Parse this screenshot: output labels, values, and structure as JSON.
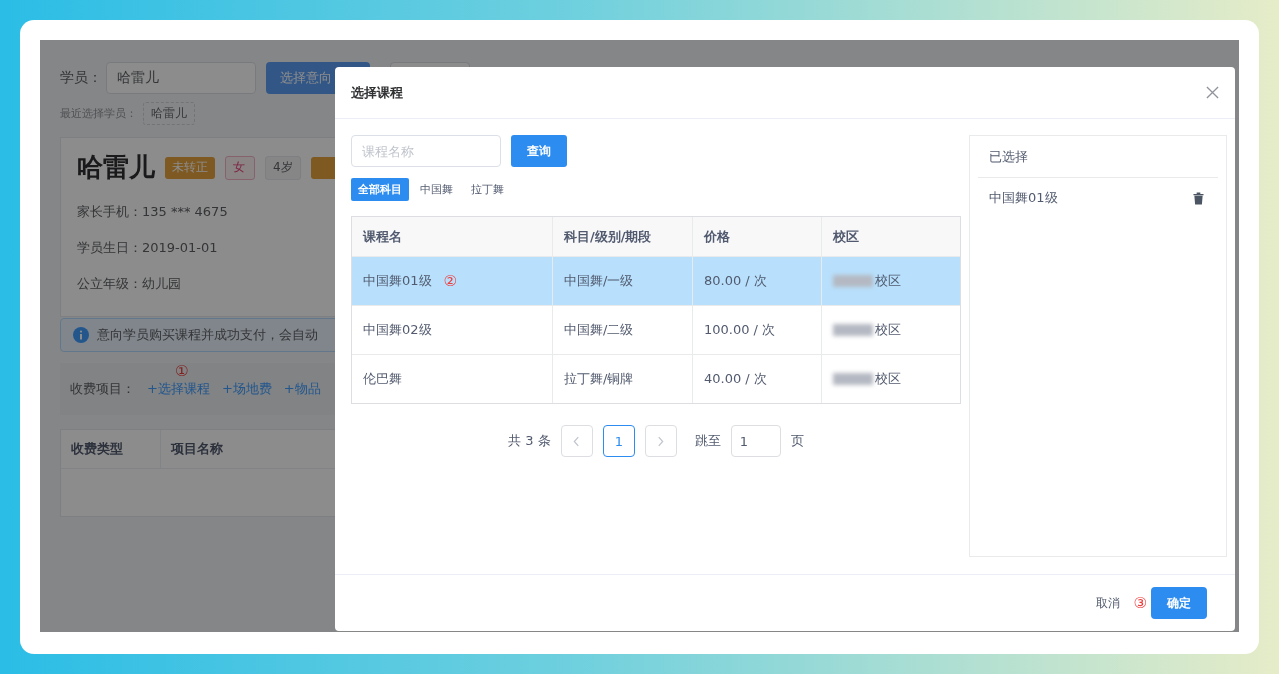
{
  "background_page": {
    "student_label": "学员：",
    "student_value": "哈雷儿",
    "select_button": "选择意向",
    "recent_label": "最近选择学员：",
    "recent_tags": [
      "哈雷儿"
    ],
    "profile": {
      "name": "哈雷儿",
      "badges": [
        {
          "text": "未转正",
          "kind": "warning"
        },
        {
          "text": "女",
          "kind": "pink"
        },
        {
          "text": "4岁",
          "kind": "plain"
        }
      ],
      "fields": [
        {
          "label": "家长手机：",
          "value": "135 *** 4675"
        },
        {
          "label": "学员生日：",
          "value": "2019-01-01"
        },
        {
          "label": "公立年级：",
          "value": "幼儿园"
        }
      ]
    },
    "notice": "意向学员购买课程并成功支付，会自动",
    "fee_label": "收费项目：",
    "fee_links": [
      {
        "text": "+选择课程",
        "step": "①"
      },
      {
        "text": "+场地费"
      },
      {
        "text": "+物品"
      }
    ],
    "table": {
      "columns": [
        "收费类型",
        "项目名称"
      ]
    }
  },
  "dialog": {
    "title": "选择课程",
    "search": {
      "placeholder": "课程名称"
    },
    "search_button": "查询",
    "filters": [
      {
        "label": "全部科目",
        "selected": true
      },
      {
        "label": "中国舞",
        "selected": false
      },
      {
        "label": "拉丁舞",
        "selected": false
      }
    ],
    "table": {
      "columns": [
        "课程名",
        "科目/级别/期段",
        "价格",
        "校区"
      ],
      "rows": [
        {
          "cells": [
            "中国舞01级",
            "中国舞/一级",
            "80.00 / 次",
            "校区"
          ],
          "step": "②",
          "selected": true
        },
        {
          "cells": [
            "中国舞02级",
            "中国舞/二级",
            "100.00 / 次",
            "校区"
          ],
          "selected": false
        },
        {
          "cells": [
            "伦巴舞",
            "拉丁舞/铜牌",
            "40.00 / 次",
            "校区"
          ],
          "selected": false
        }
      ]
    },
    "pagination": {
      "total": "共 3 条",
      "pages": [
        {
          "label": "1",
          "selected": true
        }
      ],
      "jump_label": "跳至",
      "jump_value": "1",
      "page_unit": "页"
    },
    "selected_panel": {
      "title": "已选择",
      "items": [
        "中国舞01级"
      ]
    },
    "footer": {
      "cancel": "取消",
      "step": "③",
      "confirm": "确定"
    }
  }
}
